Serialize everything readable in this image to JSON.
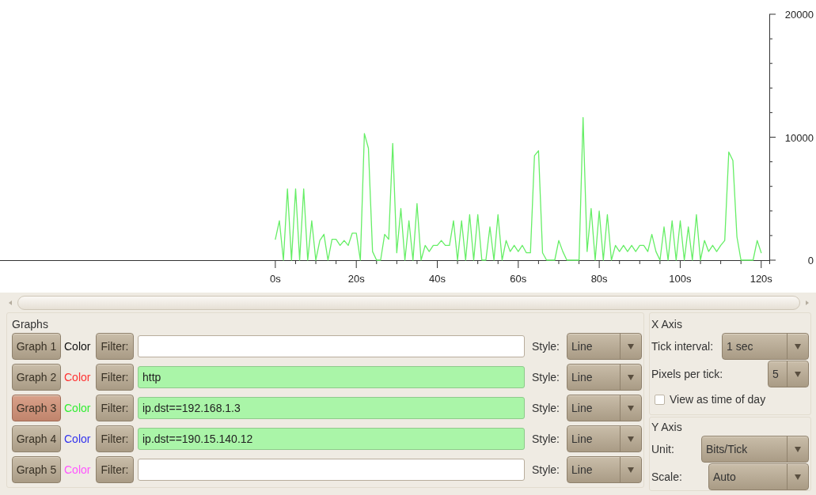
{
  "chart": {
    "chart_data": {
      "type": "line",
      "x": [
        0,
        1,
        2,
        3,
        4,
        5,
        6,
        7,
        8,
        9,
        10,
        11,
        12,
        13,
        14,
        15,
        16,
        17,
        18,
        19,
        20,
        21,
        22,
        23,
        24,
        25,
        26,
        27,
        28,
        29,
        30,
        31,
        32,
        33,
        34,
        35,
        36,
        37,
        38,
        39,
        40,
        41,
        42,
        43,
        44,
        45,
        46,
        47,
        48,
        49,
        50,
        51,
        52,
        53,
        54,
        55,
        56,
        57,
        58,
        59,
        60,
        61,
        62,
        63,
        64,
        65,
        66,
        67,
        68,
        69,
        70,
        71,
        72,
        73,
        74,
        75,
        76,
        77,
        78,
        79,
        80,
        81,
        82,
        83,
        84,
        85,
        86,
        87,
        88,
        89,
        90,
        91,
        92,
        93,
        94,
        95,
        96,
        97,
        98,
        99,
        100,
        101,
        102,
        103,
        104,
        105,
        106,
        107,
        108,
        109,
        110,
        111,
        112,
        113,
        114,
        115,
        116,
        117,
        118,
        119,
        120
      ],
      "series": [
        {
          "color": "#66ee66",
          "values": [
            1700,
            3200,
            0,
            5800,
            0,
            5800,
            0,
            5800,
            0,
            3200,
            0,
            1600,
            2100,
            0,
            1700,
            1700,
            1200,
            1600,
            1200,
            2200,
            2200,
            0,
            10300,
            9100,
            700,
            0,
            0,
            2100,
            1700,
            9500,
            600,
            4200,
            0,
            3200,
            0,
            4600,
            0,
            1200,
            700,
            1200,
            1200,
            1600,
            1200,
            1200,
            3200,
            0,
            3200,
            0,
            3700,
            0,
            3700,
            0,
            0,
            2700,
            0,
            3700,
            0,
            1600,
            700,
            1200,
            700,
            1200,
            600,
            600,
            8500,
            8900,
            600,
            0,
            0,
            0,
            1600,
            700,
            0,
            0,
            0,
            0,
            11600,
            700,
            4200,
            0,
            4000,
            0,
            3700,
            0,
            1200,
            700,
            1200,
            700,
            1200,
            700,
            1200,
            1200,
            700,
            2100,
            700,
            0,
            2700,
            0,
            3200,
            0,
            3200,
            0,
            2700,
            0,
            3700,
            0,
            1600,
            700,
            1200,
            700,
            1200,
            1600,
            8800,
            8100,
            1900,
            0,
            0,
            0,
            0,
            1600,
            600
          ]
        }
      ],
      "xlim": [
        -68,
        122
      ],
      "ylim": [
        0,
        20000
      ],
      "xticks": [
        {
          "value": 0,
          "label": "0s"
        },
        {
          "value": 20,
          "label": "20s"
        },
        {
          "value": 40,
          "label": "40s"
        },
        {
          "value": 60,
          "label": "60s"
        },
        {
          "value": 80,
          "label": "80s"
        },
        {
          "value": 100,
          "label": "100s"
        },
        {
          "value": 120,
          "label": "120s"
        }
      ],
      "yticks": [
        0,
        10000,
        20000
      ]
    }
  },
  "graphs": {
    "title": "Graphs",
    "rows": [
      {
        "button": "Graph 1",
        "on": false,
        "color_label": "Color",
        "color": "#111111",
        "filter_button": "Filter:",
        "valid": false,
        "style_label": "Style:",
        "style": "Line"
      },
      {
        "button": "Graph 2",
        "on": false,
        "color_label": "Color",
        "color": "#ff3333",
        "filter_button": "Filter:",
        "filter": "http",
        "valid": true,
        "style_label": "Style:",
        "style": "Line"
      },
      {
        "button": "Graph 3",
        "on": true,
        "color_label": "Color",
        "color": "#33ee33",
        "filter_button": "Filter:",
        "filter": "ip.dst==192.168.1.3",
        "valid": true,
        "style_label": "Style:",
        "style": "Line"
      },
      {
        "button": "Graph 4",
        "on": false,
        "color_label": "Color",
        "color": "#3333ee",
        "filter_button": "Filter:",
        "filter": "ip.dst==190.15.140.12",
        "valid": true,
        "style_label": "Style:",
        "style": "Line"
      },
      {
        "button": "Graph 5",
        "on": false,
        "color_label": "Color",
        "color": "#ff55ff",
        "filter_button": "Filter:",
        "valid": false,
        "style_label": "Style:",
        "style": "Line"
      }
    ]
  },
  "x_axis": {
    "title": "X Axis",
    "tick_interval": {
      "label": "Tick interval:",
      "value": "1 sec"
    },
    "pixels_per_tick": {
      "label": "Pixels per tick:",
      "value": "5"
    },
    "time_of_day": {
      "label": "View as time of day",
      "checked": false
    }
  },
  "y_axis": {
    "title": "Y Axis",
    "unit": {
      "label": "Unit:",
      "value": "Bits/Tick"
    },
    "scale": {
      "label": "Scale:",
      "value": "Auto"
    }
  }
}
